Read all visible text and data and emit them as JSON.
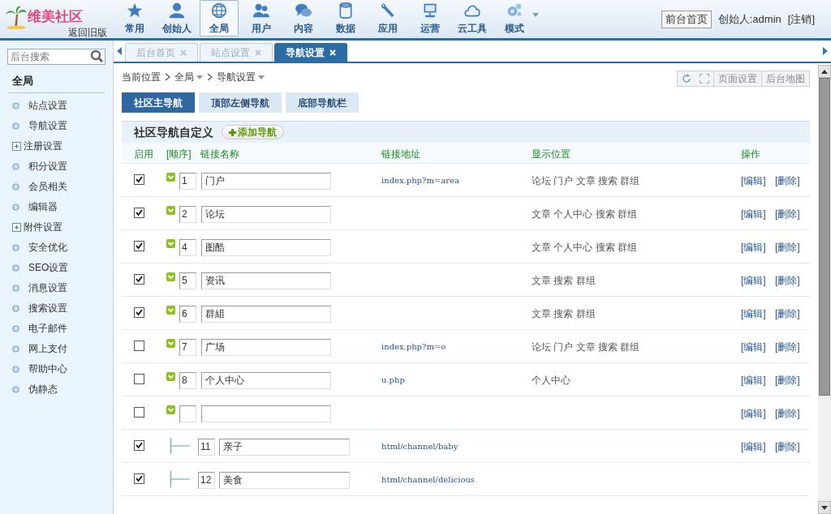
{
  "header": {
    "logo_text": "维美社区",
    "old_version": "返回旧版",
    "nav": [
      {
        "label": "常用",
        "selected": false
      },
      {
        "label": "创始人",
        "selected": false
      },
      {
        "label": "全局",
        "selected": true
      },
      {
        "label": "用户",
        "selected": false
      },
      {
        "label": "内容",
        "selected": false
      },
      {
        "label": "数据",
        "selected": false
      },
      {
        "label": "应用",
        "selected": false
      },
      {
        "label": "运营",
        "selected": false
      },
      {
        "label": "云工具",
        "selected": false
      },
      {
        "label": "模式",
        "selected": false
      }
    ],
    "front_button": "前台首页",
    "user": "创始人:admin",
    "logout": "[注销]"
  },
  "sidebar": {
    "search_placeholder": "后台搜索",
    "title": "全局",
    "items": [
      {
        "label": "站点设置",
        "kind": "leaf"
      },
      {
        "label": "导航设置",
        "kind": "leaf"
      },
      {
        "label": "注册设置",
        "kind": "expandable"
      },
      {
        "label": "积分设置",
        "kind": "leaf"
      },
      {
        "label": "会员相关",
        "kind": "leaf"
      },
      {
        "label": "编辑器",
        "kind": "leaf"
      },
      {
        "label": "附件设置",
        "kind": "expandable"
      },
      {
        "label": "安全优化",
        "kind": "leaf"
      },
      {
        "label": "SEO设置",
        "kind": "leaf"
      },
      {
        "label": "消息设置",
        "kind": "leaf"
      },
      {
        "label": "搜索设置",
        "kind": "leaf"
      },
      {
        "label": "电子邮件",
        "kind": "leaf"
      },
      {
        "label": "网上支付",
        "kind": "leaf"
      },
      {
        "label": "帮助中心",
        "kind": "leaf"
      },
      {
        "label": "伪静态",
        "kind": "leaf"
      }
    ]
  },
  "tabs": [
    {
      "label": "后台首页",
      "selected": false
    },
    {
      "label": "站点设置",
      "selected": false
    },
    {
      "label": "导航设置",
      "selected": true
    }
  ],
  "breadcrumb": [
    "当前位置",
    "全局",
    "导航设置"
  ],
  "toolbar": [
    "页面设置",
    "后台地图"
  ],
  "subtabs": [
    {
      "label": "社区主导航",
      "selected": true
    },
    {
      "label": "顶部左侧导航",
      "selected": false
    },
    {
      "label": "底部导航栏",
      "selected": false
    }
  ],
  "section": {
    "title": "社区导航自定义",
    "add_button": "添加导航"
  },
  "columns": [
    "启用",
    "[顺序]",
    "链接名称",
    "链接地址",
    "显示位置",
    "操作"
  ],
  "rows": [
    {
      "kind": "top",
      "enabled": true,
      "order": "1",
      "name": "门户",
      "url": "index.php?m=area",
      "positions": "论坛 门户 文章 搜索 群组",
      "actions": [
        "[编辑]",
        "[删除]"
      ]
    },
    {
      "kind": "top",
      "enabled": true,
      "order": "2",
      "name": "论坛",
      "positions": "文章 个人中心 搜索 群组",
      "actions": [
        "[编辑]",
        "[删除]"
      ]
    },
    {
      "kind": "top",
      "enabled": true,
      "order": "4",
      "name": "图酷",
      "positions": "文章 个人中心 搜索 群组",
      "actions": [
        "[编辑]",
        "[删除]"
      ]
    },
    {
      "kind": "top",
      "enabled": true,
      "order": "5",
      "name": "资讯",
      "positions": "文章 搜索 群组",
      "actions": [
        "[编辑]",
        "[删除]"
      ]
    },
    {
      "kind": "top",
      "enabled": true,
      "order": "6",
      "name": "群組",
      "positions": "文章 搜索 群组",
      "actions": [
        "[编辑]",
        "[删除]"
      ]
    },
    {
      "kind": "top",
      "enabled": false,
      "order": "7",
      "name": "广场",
      "url": "index.php?m=o",
      "positions": "论坛 门户 文章 搜索 群组",
      "actions": [
        "[编辑]",
        "[删除]"
      ]
    },
    {
      "kind": "top",
      "enabled": false,
      "order": "8",
      "name": "个人中心",
      "url": "u.php",
      "positions": "个人中心",
      "actions": [
        "[编辑]",
        "[删除]"
      ]
    },
    {
      "kind": "top",
      "enabled": false,
      "actions": [
        "[编辑]",
        "[删除]"
      ]
    },
    {
      "kind": "child",
      "enabled": true,
      "order": "11",
      "name": "亲子",
      "url": "html/channel/baby",
      "actions": [
        "[编辑]",
        "[删除]"
      ]
    },
    {
      "kind": "child",
      "enabled": true,
      "order": "12",
      "name": "美食",
      "url": "html/channel/delicious"
    }
  ]
}
